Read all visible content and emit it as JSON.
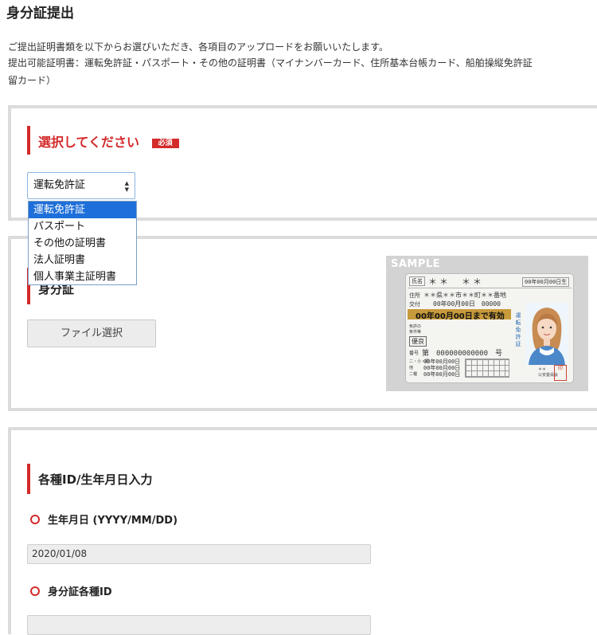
{
  "page": {
    "title": "身分証提出",
    "intro_line1": "ご提出証明書類を以下からお選びいただき、各項目のアップロードをお願いいたします。",
    "intro_line2": "提出可能証明書：運転免許証・パスポート・その他の証明書（マイナンバーカード、住所基本台帳カード、船舶操縦免許証",
    "intro_line3": "留カード）"
  },
  "select_section": {
    "title": "選択してください",
    "required_badge": "必須",
    "selected": "運転免許証",
    "options": [
      "運転免許証",
      "パスポート",
      "その他の証明書",
      "法人証明書",
      "個人事業主証明書"
    ]
  },
  "upload_section": {
    "title": "身分証",
    "file_button": "ファイル選択",
    "sample_label": "SAMPLE",
    "card": {
      "name_label": "氏名",
      "name_value": "＊＊　＊＊",
      "birth": "00年00月00日生",
      "address_label": "住所",
      "address_value": "＊＊県＊＊市＊＊町＊＊番地",
      "issue_label": "交付",
      "issue_value": "00年00月00日　00000",
      "expiry": "00年00月00日まで有効",
      "condition_label": "免許の条件等",
      "license_class": "優良",
      "number_label": "番号",
      "number_value": "第　000000000000　号",
      "vertical_text": "運転免許証",
      "date_rows": [
        "00年00月00日",
        "00年00月00日",
        "00年00月00日"
      ],
      "row_labels": [
        "二・小・原",
        "他",
        "二種"
      ],
      "authority": "＊＊\n公安委員会",
      "stamp": "印"
    }
  },
  "id_section": {
    "title": "各種ID/生年月日入力",
    "birth_label": "生年月日 (YYYY/MM/DD)",
    "birth_value": "2020/01/08",
    "id_label": "身分証各種ID",
    "id_value": ""
  },
  "colors": {
    "accent": "#d42a2a",
    "panel_border": "#dcdcdc",
    "selected_option": "#1e6fd9"
  }
}
